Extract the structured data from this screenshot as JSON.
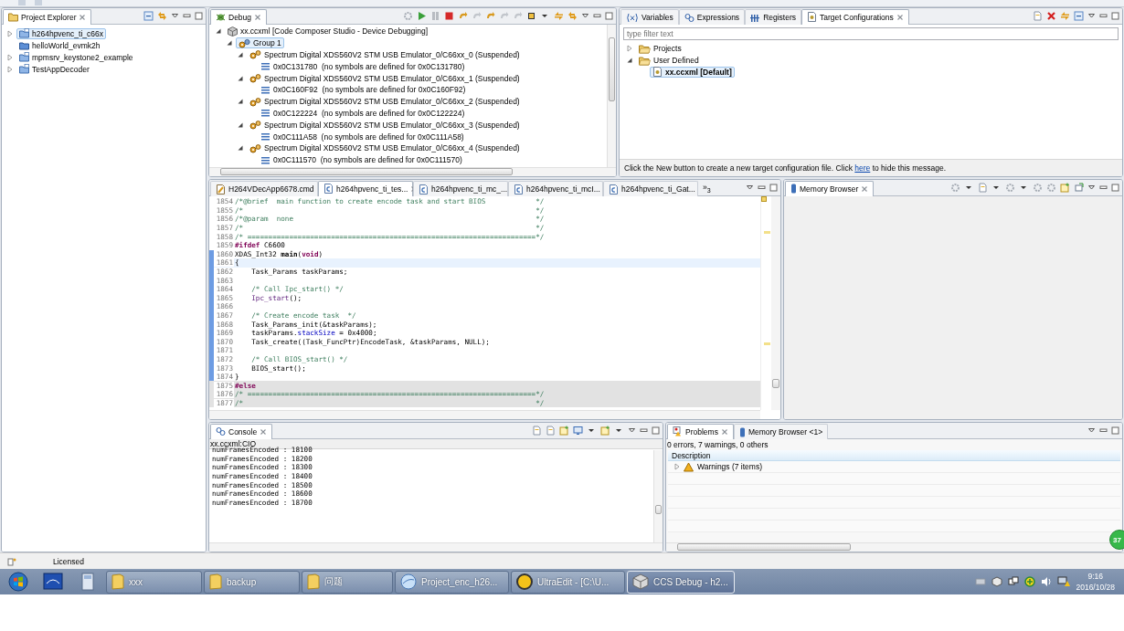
{
  "project_explorer": {
    "tab": {
      "label": "Project Explorer",
      "selected": true
    },
    "items": [
      {
        "kind": "open-project",
        "label": "h264hpvenc_ti_c66x",
        "expanded": false,
        "selected": true
      },
      {
        "kind": "closed-project",
        "label": "helloWorld_evmk2h",
        "selected": false
      },
      {
        "kind": "open-project",
        "label": "mpmsrv_keystone2_example",
        "expanded": false,
        "selected": false
      },
      {
        "kind": "open-project",
        "label": "TestAppDecoder",
        "expanded": false,
        "selected": false
      }
    ]
  },
  "debug": {
    "tab": {
      "label": "Debug",
      "selected": true
    },
    "tree": [
      {
        "kind": "launch",
        "label": "xx.ccxml [Code Composer Studio - Device Debugging]",
        "expanded": true,
        "selected": false,
        "children": [
          {
            "kind": "group",
            "label": "Group 1",
            "expanded": true,
            "selected": true,
            "children": [
              {
                "kind": "core",
                "label": "Spectrum Digital XDS560V2 STM USB Emulator_0/C66xx_0 (Suspended)",
                "expanded": true,
                "selected": false,
                "children": [
                  {
                    "kind": "frame",
                    "label": "0x0C131780  (no symbols are defined for 0x0C131780)",
                    "selected": false
                  }
                ]
              },
              {
                "kind": "core",
                "label": "Spectrum Digital XDS560V2 STM USB Emulator_0/C66xx_1 (Suspended)",
                "expanded": true,
                "selected": false,
                "children": [
                  {
                    "kind": "frame",
                    "label": "0x0C160F92  (no symbols are defined for 0x0C160F92)",
                    "selected": false
                  }
                ]
              },
              {
                "kind": "core",
                "label": "Spectrum Digital XDS560V2 STM USB Emulator_0/C66xx_2 (Suspended)",
                "expanded": true,
                "selected": false,
                "children": [
                  {
                    "kind": "frame",
                    "label": "0x0C122224  (no symbols are defined for 0x0C122224)",
                    "selected": false
                  }
                ]
              },
              {
                "kind": "core",
                "label": "Spectrum Digital XDS560V2 STM USB Emulator_0/C66xx_3 (Suspended)",
                "expanded": true,
                "selected": false,
                "children": [
                  {
                    "kind": "frame",
                    "label": "0x0C111A58  (no symbols are defined for 0x0C111A58)",
                    "selected": false
                  }
                ]
              },
              {
                "kind": "core",
                "label": "Spectrum Digital XDS560V2 STM USB Emulator_0/C66xx_4 (Suspended)",
                "expanded": true,
                "selected": false,
                "children": [
                  {
                    "kind": "frame",
                    "label": "0x0C111570  (no symbols are defined for 0x0C111570)",
                    "selected": false
                  }
                ]
              }
            ]
          }
        ]
      }
    ]
  },
  "target_panel": {
    "tabs": [
      {
        "kind": "variables",
        "label": "Variables",
        "selected": false
      },
      {
        "kind": "expressions",
        "label": "Expressions",
        "selected": false
      },
      {
        "kind": "registers",
        "label": "Registers",
        "selected": false
      },
      {
        "kind": "targets",
        "label": "Target Configurations",
        "selected": true
      }
    ],
    "filter": {
      "placeholder": "type filter text"
    },
    "tree": [
      {
        "kind": "folder",
        "label": "Projects",
        "expanded": false,
        "selected": false
      },
      {
        "kind": "folder",
        "label": "User Defined",
        "expanded": true,
        "selected": false,
        "children": [
          {
            "kind": "config",
            "label": "xx.ccxml [Default]",
            "selected": true
          }
        ]
      }
    ],
    "message": {
      "before": "Click the New button to create a new target configuration file. Click ",
      "link": "here",
      "after": " to hide this message."
    }
  },
  "editor": {
    "tabs": [
      {
        "kind": "cmd",
        "label": "H264VDecApp6678.cmd",
        "selected": false
      },
      {
        "kind": "c",
        "label": "h264hpvenc_ti_tes...",
        "selected": true
      },
      {
        "kind": "c",
        "label": "h264hpvenc_ti_mc_...",
        "selected": false
      },
      {
        "kind": "c",
        "label": "h264hpvenc_ti_mcI...",
        "selected": false
      },
      {
        "kind": "c",
        "label": "h264hpvenc_ti_Gat...",
        "selected": false
      }
    ],
    "overflow": "»$_{3}$",
    "lines": [
      {
        "number": "1854",
        "marked": false,
        "current": false,
        "inactive": false,
        "segments": [
          {
            "kind": "comment",
            "text": "/*@brief  main function to create encode task and start BIOS            */"
          }
        ]
      },
      {
        "number": "1855",
        "marked": false,
        "current": false,
        "inactive": false,
        "segments": [
          {
            "kind": "comment",
            "text": "/*                                                                      */"
          }
        ]
      },
      {
        "number": "1856",
        "marked": false,
        "current": false,
        "inactive": false,
        "segments": [
          {
            "kind": "comment",
            "text": "/*@param  none                                                          */"
          }
        ]
      },
      {
        "number": "1857",
        "marked": false,
        "current": false,
        "inactive": false,
        "segments": [
          {
            "kind": "comment",
            "text": "/*                                                                      */"
          }
        ]
      },
      {
        "number": "1858",
        "marked": false,
        "current": false,
        "inactive": false,
        "segments": [
          {
            "kind": "comment",
            "text": "/* =====================================================================*/"
          }
        ]
      },
      {
        "number": "1859",
        "marked": false,
        "current": false,
        "inactive": false,
        "segments": [
          {
            "kind": "keyword",
            "text": "#ifdef"
          },
          {
            "kind": "plain",
            "text": " C6600"
          }
        ]
      },
      {
        "number": "1860",
        "marked": true,
        "current": false,
        "inactive": false,
        "segments": [
          {
            "kind": "plain",
            "text": "XDAS_Int32 "
          },
          {
            "kind": "bold",
            "text": "main"
          },
          {
            "kind": "plain",
            "text": "("
          },
          {
            "kind": "keyword",
            "text": "void"
          },
          {
            "kind": "plain",
            "text": ")"
          }
        ]
      },
      {
        "number": "1861",
        "marked": true,
        "current": true,
        "inactive": false,
        "segments": [
          {
            "kind": "plain",
            "text": "{"
          }
        ]
      },
      {
        "number": "1862",
        "marked": true,
        "current": false,
        "inactive": false,
        "segments": [
          {
            "kind": "plain",
            "text": "    Task_Params taskParams;"
          }
        ]
      },
      {
        "number": "1863",
        "marked": true,
        "current": false,
        "inactive": false
      },
      {
        "number": "1864",
        "marked": true,
        "current": false,
        "inactive": false,
        "segments": [
          {
            "kind": "comment",
            "text": "    /* Call Ipc_start() */"
          }
        ]
      },
      {
        "number": "1865",
        "marked": true,
        "current": false,
        "inactive": false,
        "segments": [
          {
            "kind": "call",
            "text": "    Ipc_start"
          },
          {
            "kind": "plain",
            "text": "();"
          }
        ]
      },
      {
        "number": "1866",
        "marked": true,
        "current": false,
        "inactive": false
      },
      {
        "number": "1867",
        "marked": true,
        "current": false,
        "inactive": false,
        "segments": [
          {
            "kind": "comment",
            "text": "    /* Create encode task  */"
          }
        ]
      },
      {
        "number": "1868",
        "marked": true,
        "current": false,
        "inactive": false,
        "segments": [
          {
            "kind": "plain",
            "text": "    Task_Params_init(&taskParams);"
          }
        ]
      },
      {
        "number": "1869",
        "marked": true,
        "current": false,
        "inactive": false,
        "segments": [
          {
            "kind": "plain",
            "text": "    taskParams."
          },
          {
            "kind": "field",
            "text": "stackSize"
          },
          {
            "kind": "plain",
            "text": " = 0x4000;"
          }
        ]
      },
      {
        "number": "1870",
        "marked": true,
        "current": false,
        "inactive": false,
        "segments": [
          {
            "kind": "plain",
            "text": "    Task_create((Task_FuncPtr)EncodeTask, &taskParams, NULL);"
          }
        ]
      },
      {
        "number": "1871",
        "marked": true,
        "current": false,
        "inactive": false
      },
      {
        "number": "1872",
        "marked": true,
        "current": false,
        "inactive": false,
        "segments": [
          {
            "kind": "comment",
            "text": "    /* Call BIOS_start() */"
          }
        ]
      },
      {
        "number": "1873",
        "marked": true,
        "current": false,
        "inactive": false,
        "segments": [
          {
            "kind": "plain",
            "text": "    BIOS_start();"
          }
        ]
      },
      {
        "number": "1874",
        "marked": true,
        "current": false,
        "inactive": false,
        "segments": [
          {
            "kind": "plain",
            "text": "}"
          }
        ]
      },
      {
        "number": "1875",
        "marked": false,
        "current": false,
        "inactive": true,
        "segments": [
          {
            "kind": "keyword",
            "text": "#else"
          }
        ]
      },
      {
        "number": "1876",
        "marked": false,
        "current": false,
        "inactive": true,
        "segments": [
          {
            "kind": "comment",
            "text": "/* =====================================================================*/"
          }
        ]
      },
      {
        "number": "1877",
        "marked": false,
        "current": false,
        "inactive": true,
        "segments": [
          {
            "kind": "comment",
            "text": "/*                                                                      */"
          }
        ]
      }
    ]
  },
  "memory_browser": {
    "tab": {
      "label": "Memory Browser",
      "selected": true
    }
  },
  "console": {
    "tab": {
      "label": "Console",
      "selected": true
    },
    "source": "xx.ccxml:CIO",
    "lines": [
      "numFramesEncoded : 18100",
      "numFramesEncoded : 18200",
      "numFramesEncoded : 18300",
      "numFramesEncoded : 18400",
      "numFramesEncoded : 18500",
      "numFramesEncoded : 18600",
      "numFramesEncoded : 18700"
    ]
  },
  "problems": {
    "tabs": [
      {
        "kind": "problems",
        "label": "Problems",
        "selected": true
      },
      {
        "kind": "memory",
        "label": "Memory Browser <1>",
        "selected": false
      }
    ],
    "summary": "0 errors, 7 warnings, 0 others",
    "columns": [
      "Description"
    ],
    "rows": [
      {
        "label": "Warnings (7 items)",
        "expanded": false
      }
    ]
  },
  "floating_badge": "37",
  "status_bar": {
    "text": "Licensed"
  },
  "taskbar": {
    "buttons": [
      {
        "kind": "folder",
        "label": "xxx",
        "selected": false
      },
      {
        "kind": "folder",
        "label": "backup",
        "selected": false
      },
      {
        "kind": "folder",
        "label": "问题",
        "selected": false
      },
      {
        "kind": "globe",
        "label": "Project_enc_h26...",
        "selected": false
      },
      {
        "kind": "editor",
        "label": "UltraEdit - [C:\\U...",
        "selected": false
      },
      {
        "kind": "cube",
        "label": "CCS Debug - h2...",
        "selected": true
      }
    ],
    "time": "9:16",
    "date": "2016/10/28"
  }
}
